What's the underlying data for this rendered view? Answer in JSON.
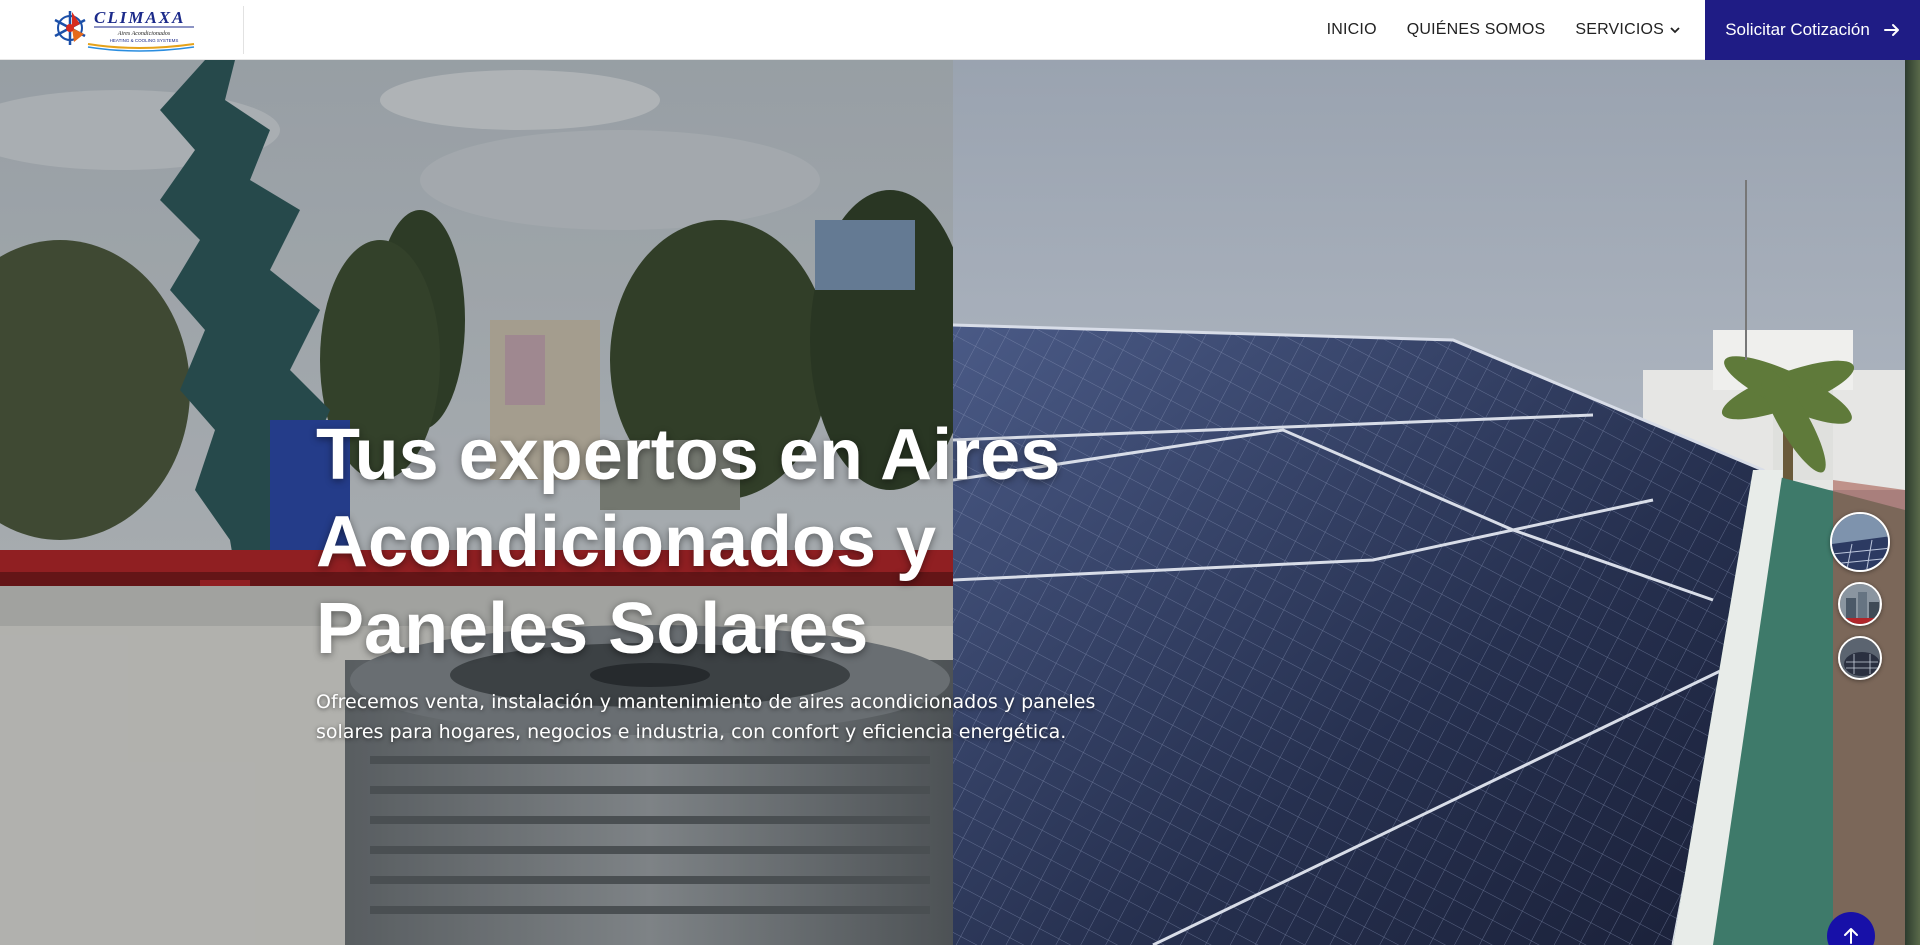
{
  "brand": {
    "name": "CLIMAXA",
    "tagline1": "Aires Acondicionados",
    "tagline2": "HEATING & COOLING SYSTEMS"
  },
  "nav": {
    "items": [
      {
        "label": "INICIO"
      },
      {
        "label": "QUIÉNES SOMOS"
      },
      {
        "label": "SERVICIOS"
      }
    ],
    "cta_label": "Solicitar Cotización"
  },
  "hero": {
    "title_line1": "Tus expertos en Aires",
    "title_line2": "Acondicionados y",
    "title_line3": "Paneles Solares",
    "subtitle": "Ofrecemos venta, instalación y mantenimiento de aires acondicionados y paneles solares para hogares, negocios e industria, con confort y eficiencia energética."
  },
  "colors": {
    "accent": "#1f1c85",
    "to_top": "#1710a8"
  },
  "icons": {
    "cta": "arrow-right-icon",
    "dropdown": "chevron-down-icon",
    "to_top": "arrow-up-icon"
  }
}
